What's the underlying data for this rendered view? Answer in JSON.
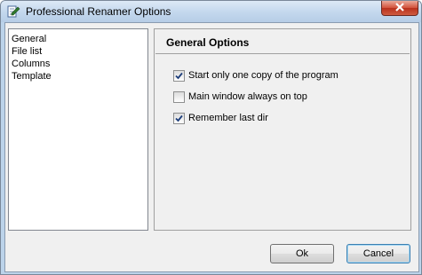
{
  "window": {
    "title": "Professional Renamer Options",
    "title_icon": "pencil-document-icon",
    "close_icon": "close-icon"
  },
  "nav": {
    "items": [
      {
        "label": "General",
        "selected": true
      },
      {
        "label": "File list",
        "selected": false
      },
      {
        "label": "Columns",
        "selected": false
      },
      {
        "label": "Template",
        "selected": false
      }
    ]
  },
  "panel": {
    "title": "General Options",
    "options": [
      {
        "label": "Start only one copy of the program",
        "checked": true
      },
      {
        "label": "Main window always on top",
        "checked": false
      },
      {
        "label": "Remember last dir",
        "checked": true
      }
    ]
  },
  "buttons": {
    "ok_label": "Ok",
    "cancel_label": "Cancel"
  },
  "colors": {
    "frame": "#bcd3ea",
    "close_button": "#c8452c",
    "checkmark": "#1c3d7a",
    "default_button_border": "#3c7fb1"
  }
}
